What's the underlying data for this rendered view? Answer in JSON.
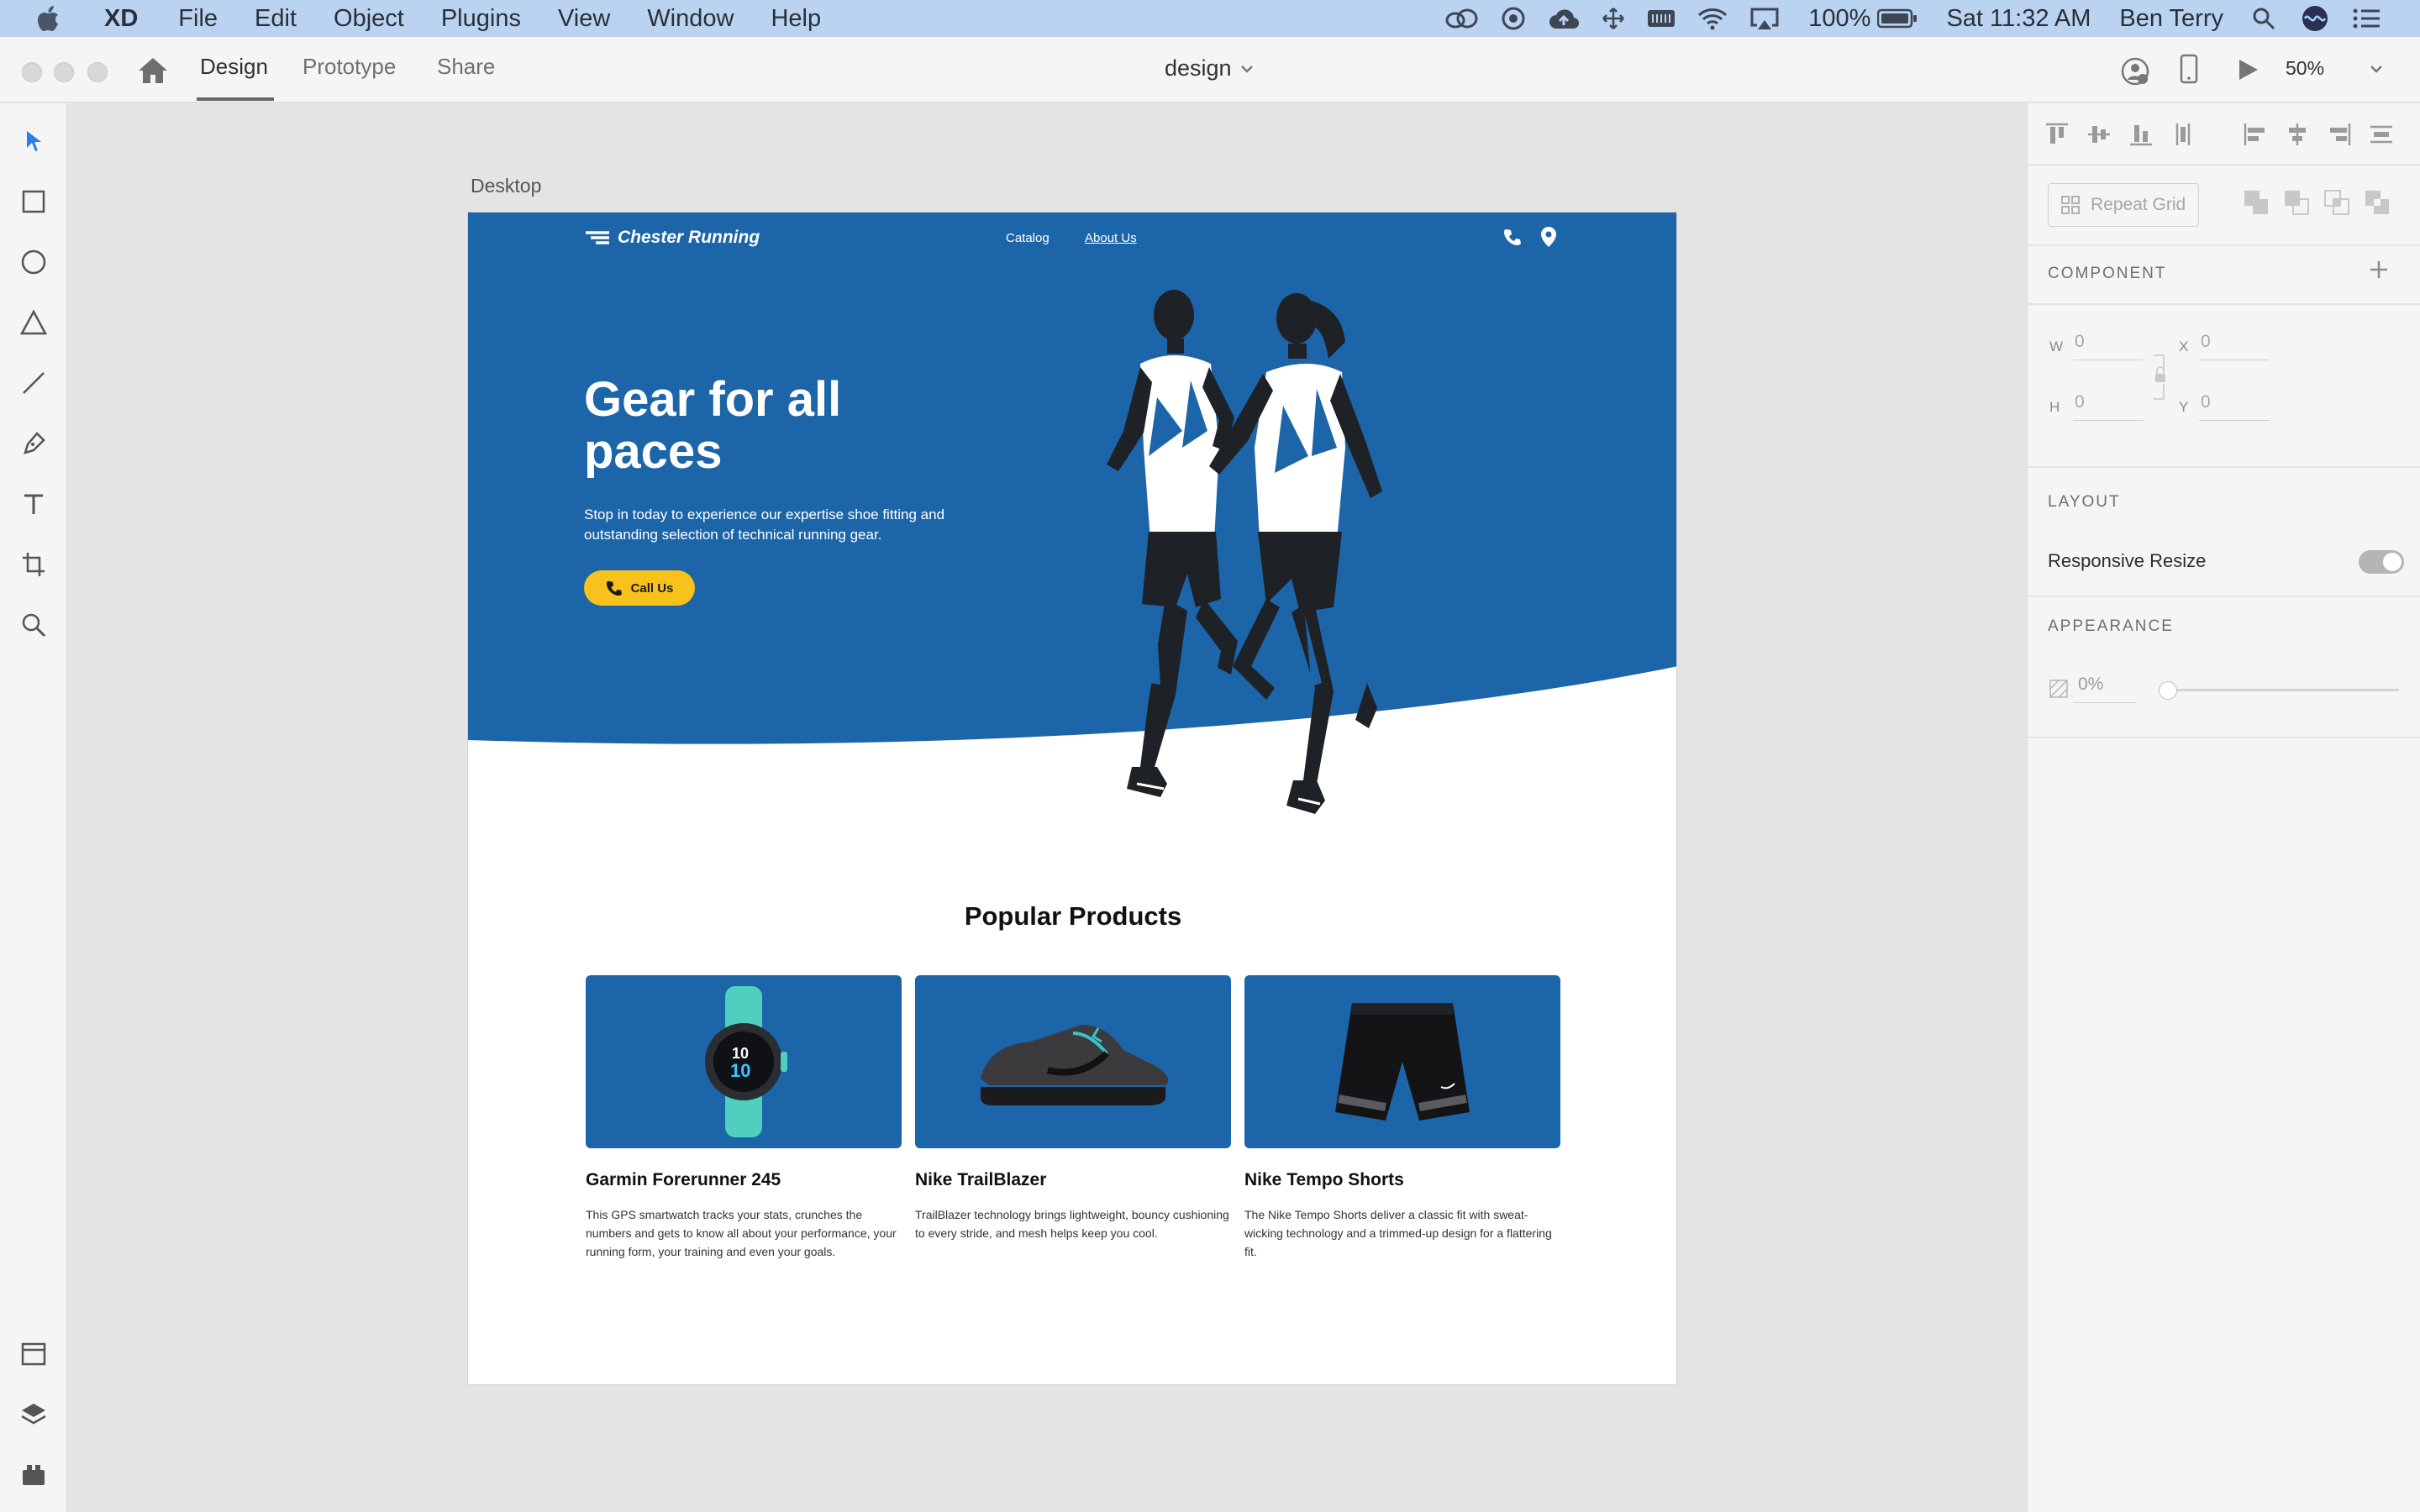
{
  "menubar": {
    "app_name": "XD",
    "menus": [
      "File",
      "Edit",
      "Object",
      "Plugins",
      "View",
      "Window",
      "Help"
    ],
    "battery": "100%",
    "datetime": "Sat 11:32 AM",
    "user": "Ben Terry"
  },
  "appbar": {
    "tabs": [
      "Design",
      "Prototype",
      "Share"
    ],
    "active_tab": "Design",
    "document_title": "design",
    "zoom": "50%"
  },
  "canvas": {
    "artboard_label": "Desktop"
  },
  "site": {
    "brand": "Chester Running",
    "nav": [
      "Catalog",
      "About Us"
    ],
    "hero_title": "Gear for all paces",
    "hero_subtitle": "Stop in today to experience our expertise shoe fitting and outstanding selection of technical running gear.",
    "cta": "Call Us",
    "products_title": "Popular Products",
    "products": [
      {
        "name": "Garmin Forerunner 245",
        "description": "This GPS smartwatch tracks your stats, crunches the numbers and gets to know all about your performance, your running form, your training and even your goals."
      },
      {
        "name": "Nike TrailBlazer",
        "description": "TrailBlazer technology brings lightweight, bouncy cushioning to every stride, and mesh helps keep you cool."
      },
      {
        "name": "Nike Tempo Shorts",
        "description": "The Nike Tempo Shorts deliver a classic fit with sweat-wicking technology and a trimmed-up design for a flattering fit."
      }
    ],
    "watch_face": {
      "line1": "10",
      "line2": "10"
    },
    "colors": {
      "primary": "#1c65a8",
      "accent": "#f7c21b"
    }
  },
  "inspector": {
    "repeat_grid": "Repeat Grid",
    "component": "COMPONENT",
    "fields": {
      "w_label": "W",
      "h_label": "H",
      "x_label": "X",
      "y_label": "Y",
      "w": "0",
      "h": "0",
      "x": "0",
      "y": "0"
    },
    "layout": "LAYOUT",
    "responsive_resize": "Responsive Resize",
    "appearance": "APPEARANCE",
    "opacity": "0%"
  }
}
